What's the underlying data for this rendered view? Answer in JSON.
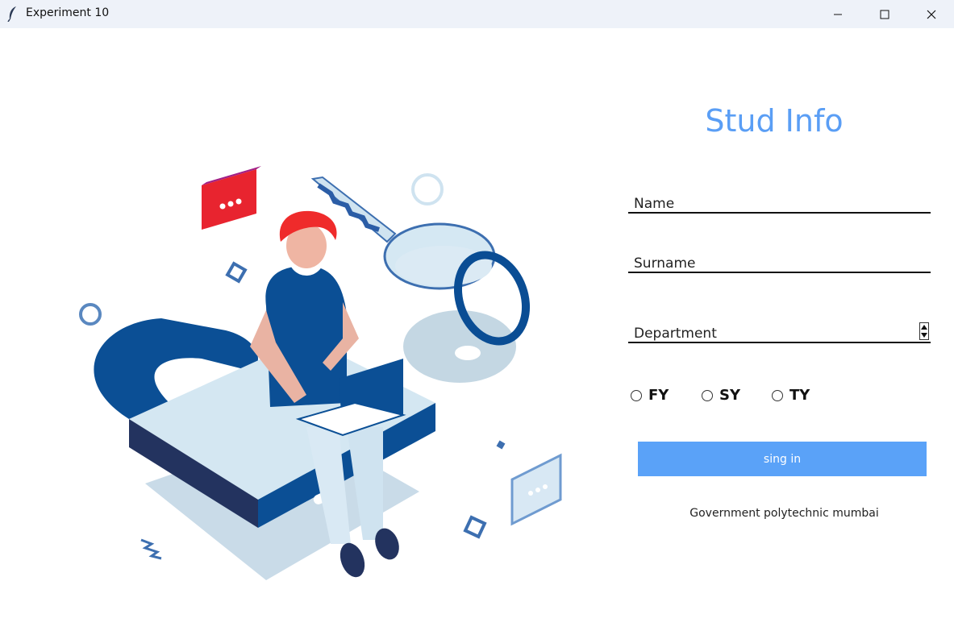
{
  "window": {
    "title": "Experiment 10",
    "icon": "feather-icon",
    "controls": [
      "minimize-icon",
      "maximize-icon",
      "close-icon"
    ]
  },
  "form": {
    "heading": "Stud Info",
    "name_placeholder": "Name",
    "surname_placeholder": "Surname",
    "department_placeholder": "Department",
    "years": [
      {
        "label": "FY",
        "selected": false
      },
      {
        "label": "SY",
        "selected": false
      },
      {
        "label": "TY",
        "selected": false
      }
    ],
    "signin_label": "sing in",
    "footer": "Government polytechnic mumbai"
  },
  "colors": {
    "accent": "#5aa2f8",
    "heading": "#5a9ef5",
    "titlebar": "#eef2f9"
  }
}
